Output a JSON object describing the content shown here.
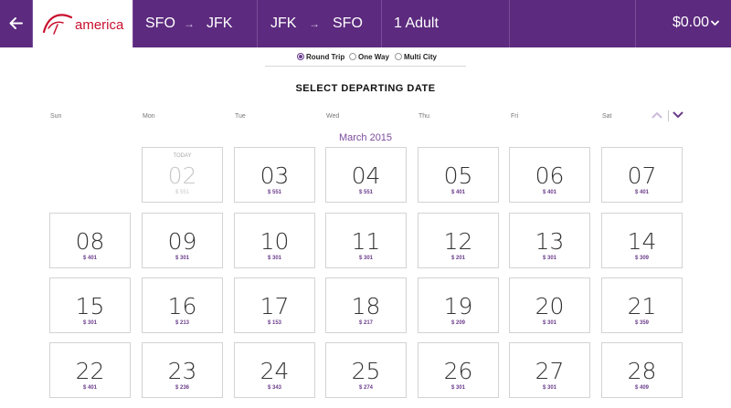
{
  "header": {
    "back_icon": "arrow-left-icon",
    "logo_text": "america",
    "outbound": {
      "from": "SFO",
      "to": "JFK"
    },
    "return": {
      "from": "JFK",
      "to": "SFO"
    },
    "arrow_glyph": "→",
    "passengers": "1 Adult",
    "total_price": "$0.00",
    "colors": {
      "bar": "#5c2a7e",
      "brand_red": "#c8102e",
      "accent": "#6b3d8c"
    }
  },
  "trip_type": {
    "options": [
      {
        "label": "Round Trip",
        "selected": true
      },
      {
        "label": "One Way",
        "selected": false
      },
      {
        "label": "Multi City",
        "selected": false
      }
    ]
  },
  "title": "SELECT DEPARTING DATE",
  "weekdays": [
    "Sun",
    "Mon",
    "Tue",
    "Wed",
    "Thu",
    "Fri",
    "Sat"
  ],
  "month": "March 2015",
  "today_label": "TODAY",
  "days": [
    {
      "day": "02",
      "fare": "$ 551",
      "today": true
    },
    {
      "day": "03",
      "fare": "$ 551"
    },
    {
      "day": "04",
      "fare": "$ 551"
    },
    {
      "day": "05",
      "fare": "$ 401"
    },
    {
      "day": "06",
      "fare": "$ 401"
    },
    {
      "day": "07",
      "fare": "$ 401"
    },
    {
      "day": "08",
      "fare": "$ 401"
    },
    {
      "day": "09",
      "fare": "$ 301"
    },
    {
      "day": "10",
      "fare": "$ 301"
    },
    {
      "day": "11",
      "fare": "$ 301"
    },
    {
      "day": "12",
      "fare": "$ 201"
    },
    {
      "day": "13",
      "fare": "$ 301"
    },
    {
      "day": "14",
      "fare": "$ 309"
    },
    {
      "day": "15",
      "fare": "$ 301"
    },
    {
      "day": "16",
      "fare": "$ 213"
    },
    {
      "day": "17",
      "fare": "$ 153"
    },
    {
      "day": "18",
      "fare": "$ 217"
    },
    {
      "day": "19",
      "fare": "$ 209"
    },
    {
      "day": "20",
      "fare": "$ 301"
    },
    {
      "day": "21",
      "fare": "$ 359"
    },
    {
      "day": "22",
      "fare": "$ 401"
    },
    {
      "day": "23",
      "fare": "$ 236"
    },
    {
      "day": "24",
      "fare": "$ 343"
    },
    {
      "day": "25",
      "fare": "$ 274"
    },
    {
      "day": "26",
      "fare": "$ 301"
    },
    {
      "day": "27",
      "fare": "$ 301"
    },
    {
      "day": "28",
      "fare": "$ 409"
    }
  ]
}
